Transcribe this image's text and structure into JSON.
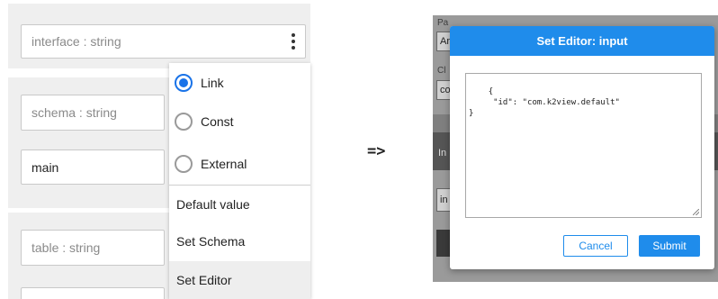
{
  "left": {
    "interface_field": "interface : string",
    "schema_field": "schema : string",
    "schema_value": "main",
    "table_field": "table : string",
    "menu": {
      "link": "Link",
      "const": "Const",
      "external": "External",
      "default_value": "Default value",
      "set_schema": "Set Schema",
      "set_editor": "Set Editor"
    }
  },
  "arrow": "=>",
  "background": {
    "label1": "Pa",
    "input1": "Ar",
    "label2": "Cl",
    "input2": "co",
    "label3": "In",
    "input3": "in"
  },
  "modal": {
    "title": "Set Editor: input",
    "editor_content": "{\n     \"id\": \"com.k2view.default\"\n}",
    "cancel_label": "Cancel",
    "submit_label": "Submit"
  },
  "colors": {
    "accent": "#1f8ceb",
    "radio_selected": "#1a73e8"
  }
}
